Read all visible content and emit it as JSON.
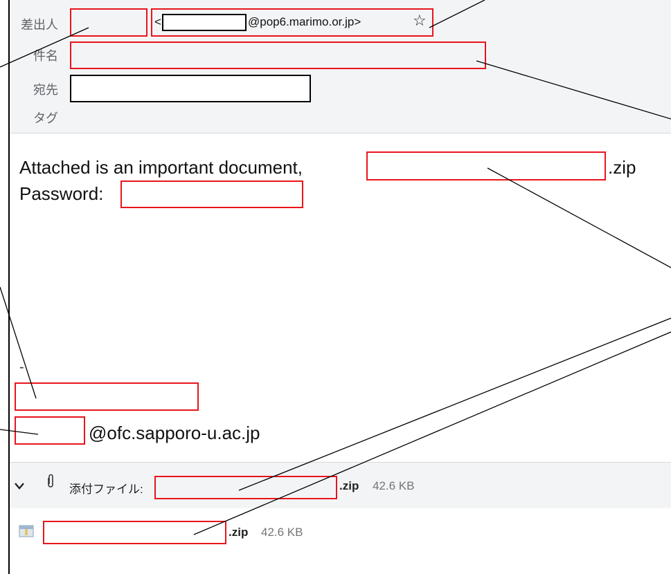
{
  "header": {
    "from_label": "差出人",
    "from_email_prefix": "<",
    "from_email_domain": "@pop6.marimo.or.jp>",
    "star_icon": "☆",
    "subject_label": "件名",
    "to_label": "宛先",
    "tags_label": "タグ"
  },
  "body": {
    "line1": "Attached is an important document,",
    "line1_suffix": ".zip",
    "line2": "Password:",
    "separator": "-",
    "signature_email_domain": "@ofc.sapporo-u.ac.jp"
  },
  "attachments": {
    "bar_label": "添付ファイル:",
    "bar_ext": ".zip",
    "bar_size": "42.6 KB",
    "file_ext": ".zip",
    "file_size": "42.6 KB"
  },
  "colors": {
    "redaction": "#e8141b",
    "header_bg": "#f3f4f6"
  }
}
